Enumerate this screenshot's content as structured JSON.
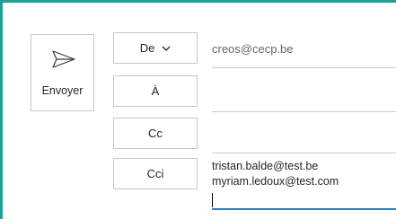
{
  "send": {
    "label": "Envoyer",
    "icon": "send-icon"
  },
  "fields": {
    "from": {
      "label": "De",
      "icon": "chevron-down-icon",
      "value": "creos@cecp.be"
    },
    "to": {
      "label": "À",
      "value": ""
    },
    "cc": {
      "label": "Cc",
      "value": ""
    },
    "bcc": {
      "label": "Cci",
      "recipients": [
        "tristan.balde@test.be",
        "myriam.ledoux@test.com"
      ]
    }
  },
  "colors": {
    "accent": "#1aa39a",
    "active_underline": "#2b7bc0",
    "border": "#c6c6c6",
    "text": "#262626",
    "muted_text": "#666666"
  }
}
